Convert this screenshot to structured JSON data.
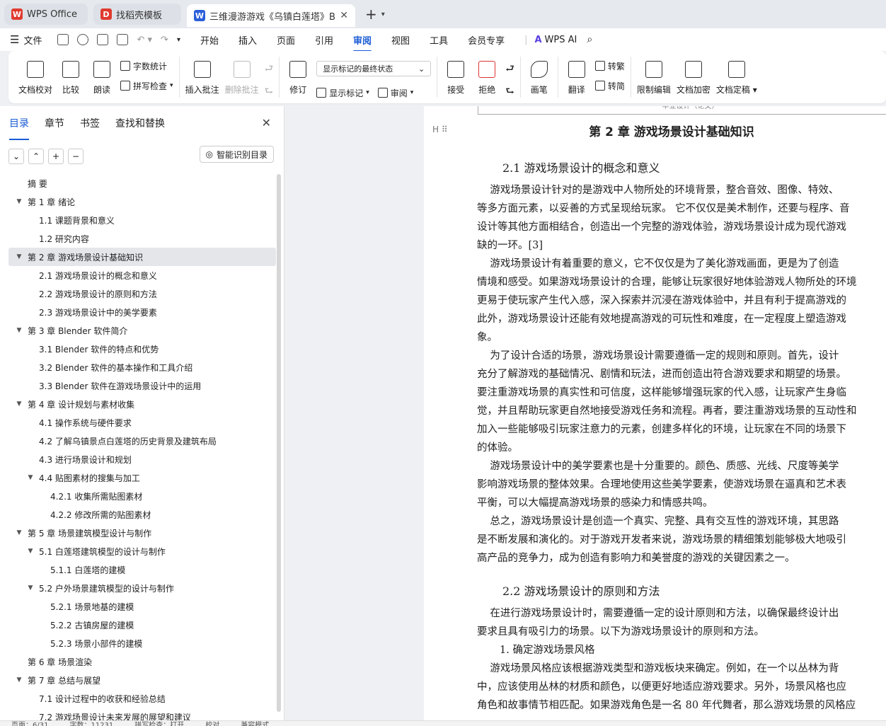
{
  "tabs": [
    {
      "title": "WPS Office",
      "logo": "W",
      "logo_color": "#e03a2f"
    },
    {
      "title": "找稻壳模板",
      "logo": "D",
      "logo_color": "#e03a2f"
    },
    {
      "title": "三维漫游游戏《乌镇白莲塔》B",
      "logo": "W",
      "logo_color": "#2b5fd9"
    }
  ],
  "menu": {
    "file": "文件",
    "items": [
      "开始",
      "插入",
      "页面",
      "引用",
      "审阅",
      "视图",
      "工具",
      "会员专享"
    ],
    "active": "审阅",
    "ai": "WPS AI"
  },
  "ribbon": {
    "doc_check": "文档校对",
    "compare": "比较",
    "read_aloud": "朗读",
    "word_count": "字数统计",
    "spell_check": "拼写检查",
    "insert_comment": "插入批注",
    "delete_comment": "删除批注",
    "revise": "修订",
    "markup_state": "显示标记的最终状态",
    "show_markup": "显示标记",
    "review": "审阅",
    "accept": "接受",
    "reject": "拒绝",
    "pen": "画笔",
    "translate": "翻译",
    "to_traditional": "转繁",
    "to_simplified": "转简",
    "restrict_edit": "限制编辑",
    "encrypt": "文档加密",
    "finalize": "文档定稿"
  },
  "nav": {
    "tabs": [
      "目录",
      "章节",
      "书签",
      "查找和替换"
    ],
    "active_tab": "目录",
    "smart_toc": "智能识别目录",
    "toc": [
      {
        "label": "摘    要",
        "level": 1,
        "arrow": ""
      },
      {
        "label": "第 1 章  绪论",
        "level": 1,
        "arrow": "▼"
      },
      {
        "label": "1.1  课题背景和意义",
        "level": 2,
        "arrow": ""
      },
      {
        "label": "1.2 研究内容",
        "level": 2,
        "arrow": ""
      },
      {
        "label": "第 2 章  游戏场景设计基础知识",
        "level": 1,
        "arrow": "▼",
        "selected": true
      },
      {
        "label": "2.1 游戏场景设计的概念和意义",
        "level": 2,
        "arrow": ""
      },
      {
        "label": "2.2 游戏场景设计的原则和方法",
        "level": 2,
        "arrow": ""
      },
      {
        "label": "2.3  游戏场景设计中的美学要素",
        "level": 2,
        "arrow": ""
      },
      {
        "label": "第 3 章  Blender 软件简介",
        "level": 1,
        "arrow": "▼"
      },
      {
        "label": "3.1 Blender 软件的特点和优势",
        "level": 2,
        "arrow": ""
      },
      {
        "label": "3.2 Blender 软件的基本操作和工具介绍",
        "level": 2,
        "arrow": ""
      },
      {
        "label": "3.3 Blender 软件在游戏场景设计中的运用",
        "level": 2,
        "arrow": ""
      },
      {
        "label": "第 4 章  设计规划与素材收集",
        "level": 1,
        "arrow": "▼"
      },
      {
        "label": "4.1  操作系统与硬件要求",
        "level": 2,
        "arrow": ""
      },
      {
        "label": "4.2  了解乌镇景点白莲塔的历史背景及建筑布局",
        "level": 2,
        "arrow": ""
      },
      {
        "label": "4.3 进行场景设计和规划",
        "level": 2,
        "arrow": ""
      },
      {
        "label": "4.4  贴图素材的搜集与加工",
        "level": 2,
        "arrow": "▼"
      },
      {
        "label": "4.2.1 收集所需贴图素材",
        "level": 3,
        "arrow": ""
      },
      {
        "label": "4.2.2 修改所需的贴图素材",
        "level": 3,
        "arrow": ""
      },
      {
        "label": "第 5 章  场景建筑模型设计与制作",
        "level": 1,
        "arrow": "▼"
      },
      {
        "label": "5.1  白莲塔建筑模型的设计与制作",
        "level": 2,
        "arrow": "▼"
      },
      {
        "label": "5.1.1 白莲塔的建模",
        "level": 3,
        "arrow": ""
      },
      {
        "label": "5.2  户外场景建筑模型的设计与制作",
        "level": 2,
        "arrow": "▼"
      },
      {
        "label": "5.2.1 场景地基的建模",
        "level": 3,
        "arrow": ""
      },
      {
        "label": "5.2.2 古镇房屋的建模",
        "level": 3,
        "arrow": ""
      },
      {
        "label": "5.2.3 场景小部件的建模",
        "level": 3,
        "arrow": ""
      },
      {
        "label": "第 6 章  场景渲染",
        "level": 1,
        "arrow": ""
      },
      {
        "label": "第 7 章  总结与展望",
        "level": 1,
        "arrow": "▼"
      },
      {
        "label": "7.1  设计过程中的收获和经验总结",
        "level": 2,
        "arrow": ""
      },
      {
        "label": "7.2  游戏场景设计未来发展的展望和建议",
        "level": 2,
        "arrow": ""
      }
    ]
  },
  "doc": {
    "header_text": "毕业设计（论文）",
    "chapter_title": "第 2 章  游戏场景设计基础知识",
    "section1_title": "2.1 游戏场景设计的概念和意义",
    "section1_lines": [
      "    游戏场景设计针对的是游戏中人物所处的环境背景，整合音效、图像、特效、",
      "等多方面元素，以妥善的方式呈现给玩家。 它不仅仅是美术制作，还要与程序、音",
      "设计等其他方面相结合，创造出一个完整的游戏体验，游戏场景设计成为现代游戏",
      "缺的一环。[3]",
      "    游戏场景设计有着重要的意义，它不仅仅是为了美化游戏画面，更是为了创造",
      "情境和感受。如果游戏场景设计的合理，能够让玩家很好地体验游戏人物所处的环境",
      "更易于使玩家产生代入感，深入探索并沉浸在游戏体验中，并且有利于提高游戏的",
      "此外，游戏场景设计还能有效地提高游戏的可玩性和难度，在一定程度上塑造游戏",
      "象。",
      "    为了设计合适的场景，游戏场景设计需要遵循一定的规则和原则。首先，设计",
      "充分了解游戏的基础情况、剧情和玩法，进而创造出符合游戏要求和期望的场景。",
      "要注重游戏场景的真实性和可信度，这样能够增强玩家的代入感，让玩家产生身临",
      "觉，并且帮助玩家更自然地接受游戏任务和流程。再者，要注重游戏场景的互动性和",
      "加入一些能够吸引玩家注意力的元素，创建多样化的环境，让玩家在不同的场景下",
      "的体验。",
      "    游戏场景设计中的美学要素也是十分重要的。颜色、质感、光线、尺度等美学",
      "影响游戏场景的整体效果。合理地使用这些美学要素，使游戏场景在逼真和艺术表",
      "平衡，可以大幅提高游戏场景的感染力和情感共鸣。",
      "    总之，游戏场景设计是创造一个真实、完整、具有交互性的游戏环境，其思路",
      "是不断发展和演化的。对于游戏开发者来说，游戏场景的精细策划能够极大地吸引",
      "高产品的竞争力，成为创造有影响力和美誉度的游戏的关键因素之一。"
    ],
    "section2_title": "2.2 游戏场景设计的原则和方法",
    "section2_lines": [
      "    在进行游戏场景设计时，需要遵循一定的设计原则和方法，以确保最终设计出",
      "要求且具有吸引力的场景。以下为游戏场景设计的原则和方法。"
    ],
    "list_item": "1. 确定游戏场景风格",
    "section2_more": [
      "    游戏场景风格应该根据游戏类型和游戏板块来确定。例如，在一个以丛林为背",
      "中，应该使用丛林的材质和颜色，以便更好地适应游戏要求。另外，场景风格也应",
      "角色和故事情节相匹配。如果游戏角色是一名 80 年代舞者，那么游戏场景的风格应"
    ]
  },
  "status": {
    "page": "页面：6/31",
    "words": "字数：11231",
    "spell": "拼写检查：打开",
    "proof": "校对",
    "compat": "兼容模式"
  }
}
